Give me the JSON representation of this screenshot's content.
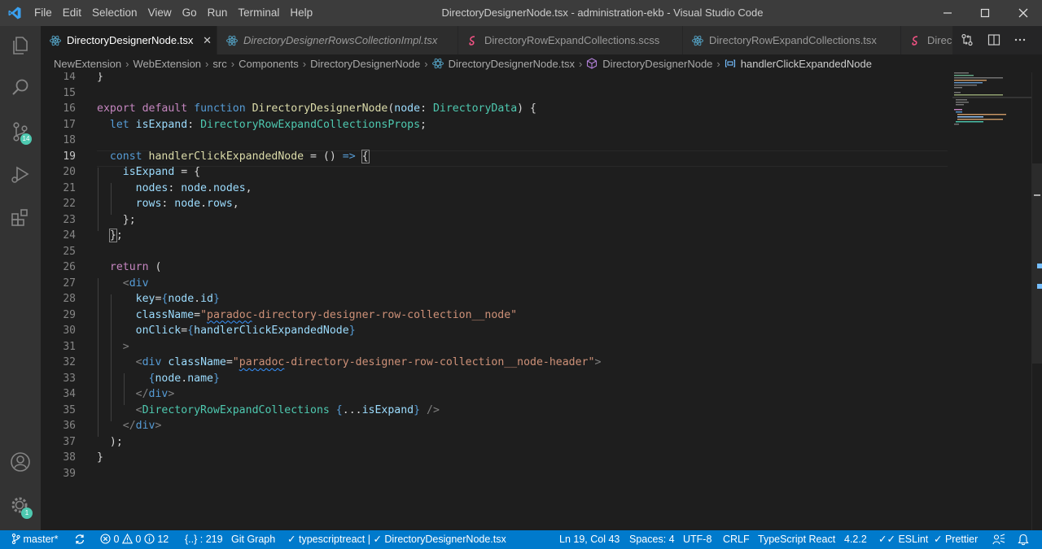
{
  "window": {
    "title": "DirectoryDesignerNode.tsx - administration-ekb - Visual Studio Code",
    "menu": [
      "File",
      "Edit",
      "Selection",
      "View",
      "Go",
      "Run",
      "Terminal",
      "Help"
    ]
  },
  "activity_bar": {
    "source_control_badge": "14",
    "settings_badge": "1"
  },
  "tabs": [
    {
      "label": "DirectoryDesignerNode.tsx",
      "icon": "react-icon",
      "active": true,
      "close": "✕"
    },
    {
      "label": "DirectoryDesignerRowsCollectionImpl.tsx",
      "icon": "react-icon",
      "active": false
    },
    {
      "label": "DirectoryRowExpandCollections.scss",
      "icon": "sass-icon",
      "active": false
    },
    {
      "label": "DirectoryRowExpandCollections.tsx",
      "icon": "react-icon",
      "active": false
    },
    {
      "label": "Direc",
      "icon": "sass-icon",
      "active": false
    }
  ],
  "breadcrumbs": [
    "NewExtension",
    "WebExtension",
    "src",
    "Components",
    "DirectoryDesignerNode",
    "DirectoryDesignerNode.tsx",
    "DirectoryDesignerNode",
    "handlerClickExpandedNode"
  ],
  "editor": {
    "line_numbers": [
      "14",
      "15",
      "16",
      "17",
      "18",
      "19",
      "20",
      "21",
      "22",
      "23",
      "24",
      "25",
      "26",
      "27",
      "28",
      "29",
      "30",
      "31",
      "32",
      "33",
      "34",
      "35",
      "36",
      "37",
      "38",
      "39"
    ],
    "current_line": "19"
  },
  "colors": {
    "status_bar": "#007acc",
    "editor_bg": "#1e1e1e",
    "title_bar": "#3c3c3c",
    "activity_bar": "#333333",
    "badge": "#4ec9b0"
  },
  "status_bar": {
    "branch": "master*",
    "errors": "0",
    "warnings": "0",
    "infos": "12",
    "braces": "{..} : 219",
    "git_graph": "Git Graph",
    "language_check": "typescriptreact | ✓ DirectoryDesignerNode.tsx",
    "position": "Ln 19, Col 43",
    "spaces": "Spaces: 4",
    "encoding": "UTF-8",
    "eol": "CRLF",
    "language": "TypeScript React",
    "ts_version": "4.2.2",
    "eslint": "ESLint",
    "prettier": "Prettier"
  }
}
